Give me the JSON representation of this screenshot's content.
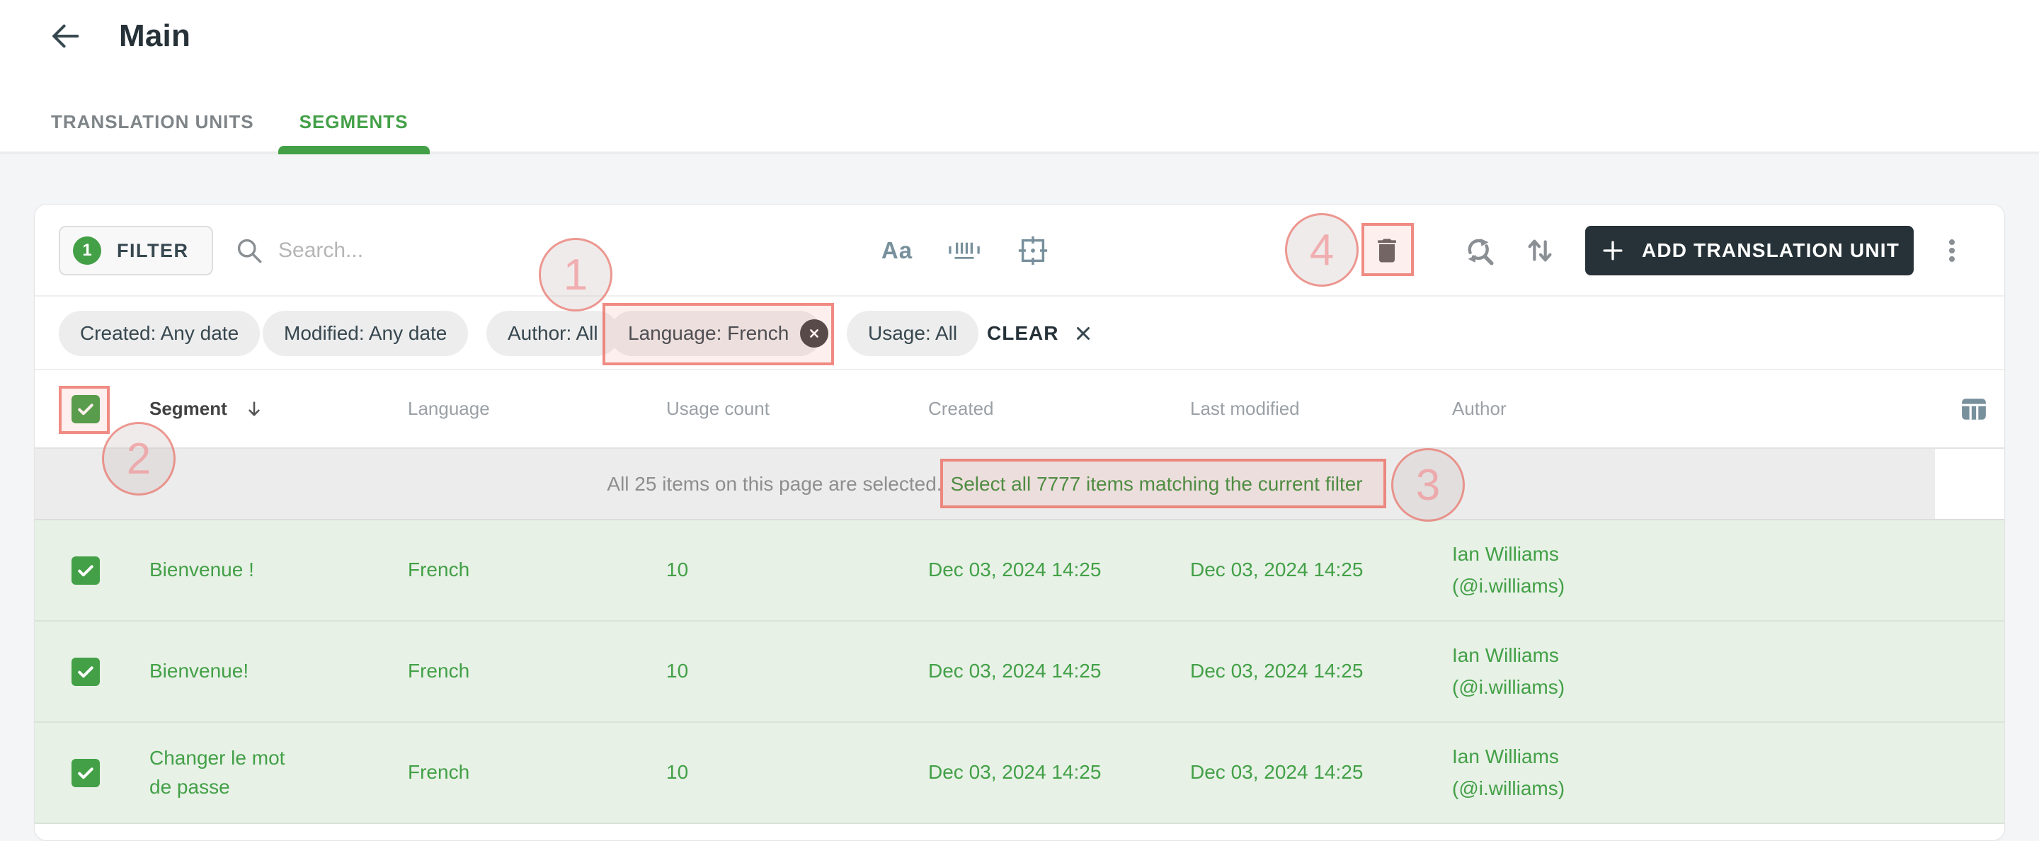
{
  "header": {
    "title": "Main"
  },
  "tabs": [
    {
      "label": "TRANSLATION UNITS",
      "active": false
    },
    {
      "label": "SEGMENTS",
      "active": true
    }
  ],
  "toolbar": {
    "filter_label": "FILTER",
    "filter_count": "1",
    "search_placeholder": "Search...",
    "match_case_glyph": "Aa",
    "add_label": "ADD TRANSLATION UNIT"
  },
  "filters": {
    "chips": [
      {
        "label": "Created: Any date"
      },
      {
        "label": "Modified: Any date"
      },
      {
        "label": "Author: All"
      },
      {
        "label": "Language: French",
        "removable": true
      },
      {
        "label": "Usage: All"
      }
    ],
    "clear_label": "CLEAR"
  },
  "table": {
    "columns": [
      "Segment",
      "Language",
      "Usage count",
      "Created",
      "Last modified",
      "Author"
    ],
    "selection_banner": {
      "text": "All 25 items on this page are selected.",
      "link": "Select all 7777 items matching the current filter"
    },
    "rows": [
      {
        "selected": true,
        "segment": "Bienvenue !",
        "language": "French",
        "usage_count": "10",
        "created": "Dec 03, 2024 14:25",
        "modified": "Dec 03, 2024 14:25",
        "author_name": "Ian Williams",
        "author_handle": "(@i.williams)"
      },
      {
        "selected": true,
        "segment": "Bienvenue!",
        "language": "French",
        "usage_count": "10",
        "created": "Dec 03, 2024 14:25",
        "modified": "Dec 03, 2024 14:25",
        "author_name": "Ian Williams",
        "author_handle": "(@i.williams)"
      },
      {
        "selected": true,
        "segment": "Changer le mot de passe",
        "language": "French",
        "usage_count": "10",
        "created": "Dec 03, 2024 14:25",
        "modified": "Dec 03, 2024 14:25",
        "author_name": "Ian Williams",
        "author_handle": "(@i.williams)"
      }
    ]
  },
  "annotations": [
    {
      "label": "1"
    },
    {
      "label": "2"
    },
    {
      "label": "3"
    },
    {
      "label": "4"
    }
  ],
  "colors": {
    "green": "#43a047",
    "link_green": "#388e3c",
    "dark": "#263238",
    "annotation_red": "#eb6a60",
    "row_bg": "#e7f1e6",
    "banner_bg": "#ececec"
  }
}
